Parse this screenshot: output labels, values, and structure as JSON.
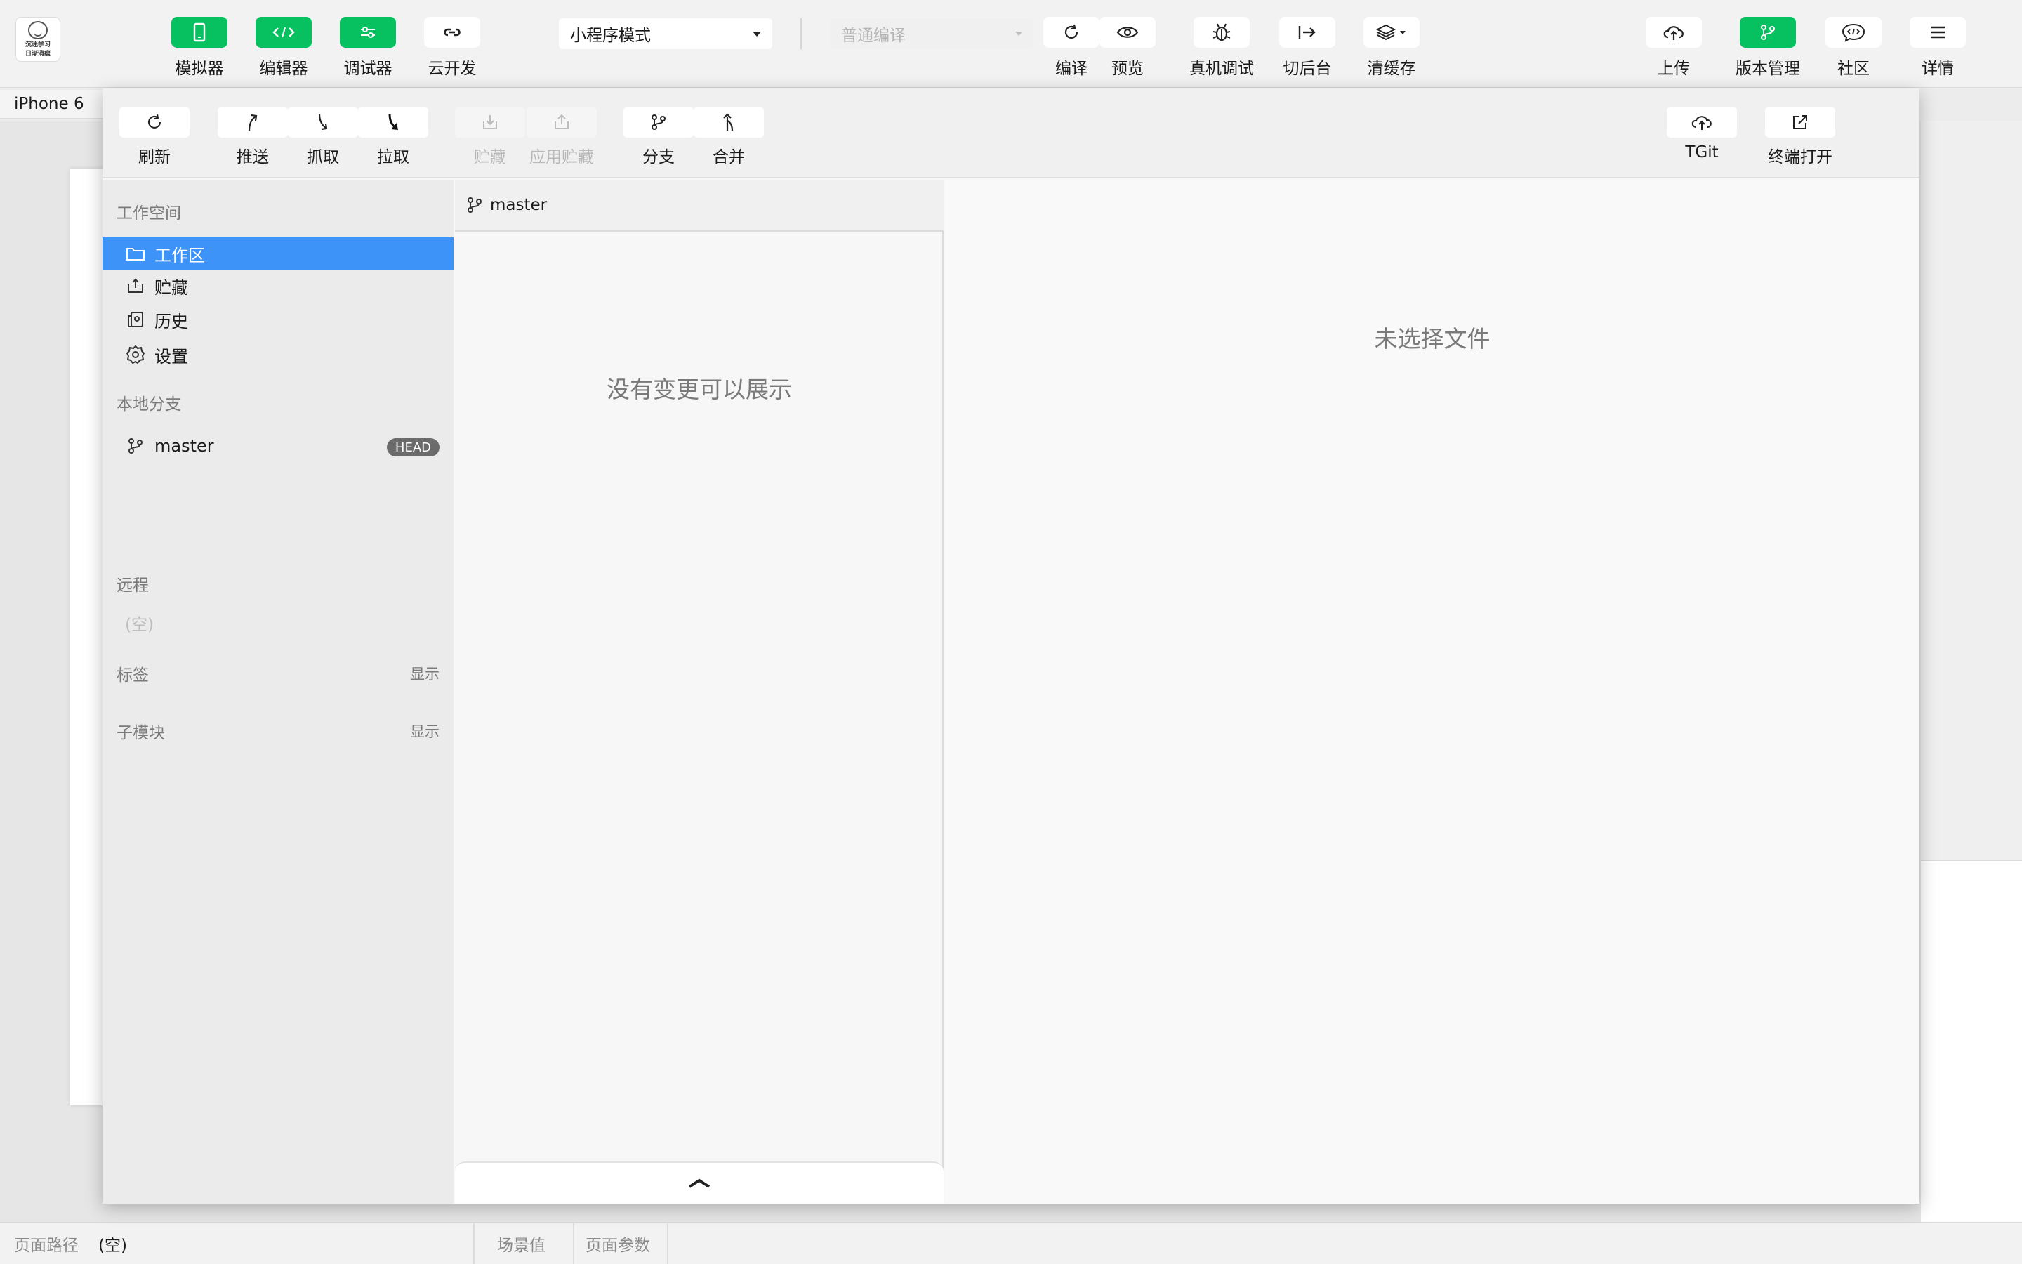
{
  "app": {
    "logo_text_line1": "沉迷学习",
    "logo_text_line2": "日渐消瘦"
  },
  "toolbar": {
    "simulator": "模拟器",
    "editor": "编辑器",
    "debugger": "调试器",
    "cloud_dev": "云开发",
    "mode_select": "小程序模式",
    "compile_select_placeholder": "普通编译",
    "compile": "编译",
    "preview": "预览",
    "real_device_debug": "真机调试",
    "background": "切后台",
    "clear_cache": "清缓存",
    "upload": "上传",
    "version_mgmt": "版本管理",
    "community": "社区",
    "details": "详情",
    "accent_color": "#07c160"
  },
  "device": {
    "name": "iPhone 6"
  },
  "git_toolbar": {
    "refresh": "刷新",
    "push": "推送",
    "fetch": "抓取",
    "pull": "拉取",
    "stash": "贮藏",
    "apply_stash": "应用贮藏",
    "branch": "分支",
    "merge": "合并",
    "tgit": "TGit",
    "open_terminal": "终端打开"
  },
  "sidebar": {
    "workspace_title": "工作空间",
    "items": [
      {
        "label": "工作区",
        "icon": "folder-icon",
        "active": true
      },
      {
        "label": "贮藏",
        "icon": "stash-icon",
        "active": false
      },
      {
        "label": "历史",
        "icon": "history-icon",
        "active": false
      },
      {
        "label": "设置",
        "icon": "gear-icon",
        "active": false
      }
    ],
    "local_branches_title": "本地分支",
    "local_branch": {
      "name": "master",
      "badge": "HEAD"
    },
    "remote_title": "远程",
    "remote_empty": "(空)",
    "tags_title": "标签",
    "tags_action": "显示",
    "submodules_title": "子模块",
    "submodules_action": "显示",
    "active_color": "#3d93f8"
  },
  "changes_panel": {
    "branch": "master",
    "empty_message": "没有变更可以展示"
  },
  "preview_panel": {
    "empty_message": "未选择文件"
  },
  "statusbar": {
    "page_path_label": "页面路径",
    "page_path_value": "(空)",
    "scene_value": "场景值",
    "page_params": "页面参数"
  }
}
